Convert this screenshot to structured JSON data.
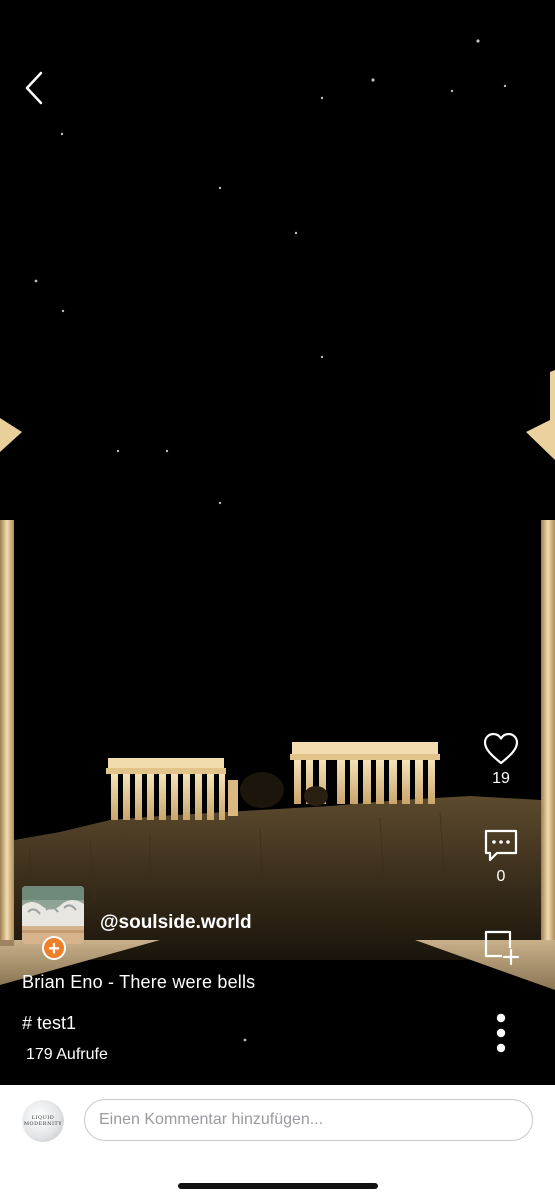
{
  "post": {
    "username": "@soulside.world",
    "title": "Brian Eno - There were bells",
    "hashtag": "# test1",
    "views": "179 Aufrufe"
  },
  "actions": {
    "likes": "19",
    "comments": "0"
  },
  "icons": {
    "back": "chevron-left-icon",
    "like": "heart-outline-icon",
    "comment": "speech-bubble-dots-icon",
    "save": "add-to-collection-icon",
    "more": "vertical-dots-icon",
    "follow": "plus-icon"
  },
  "comment_bar": {
    "placeholder": "Einen Kommentar hinzufügen...",
    "avatar_text": "LIQUID MODERNITY"
  },
  "colors": {
    "background": "#000000",
    "follow_badge": "#f07f2a",
    "monument_light": "#e8c98a",
    "bar_background": "#ffffff"
  }
}
